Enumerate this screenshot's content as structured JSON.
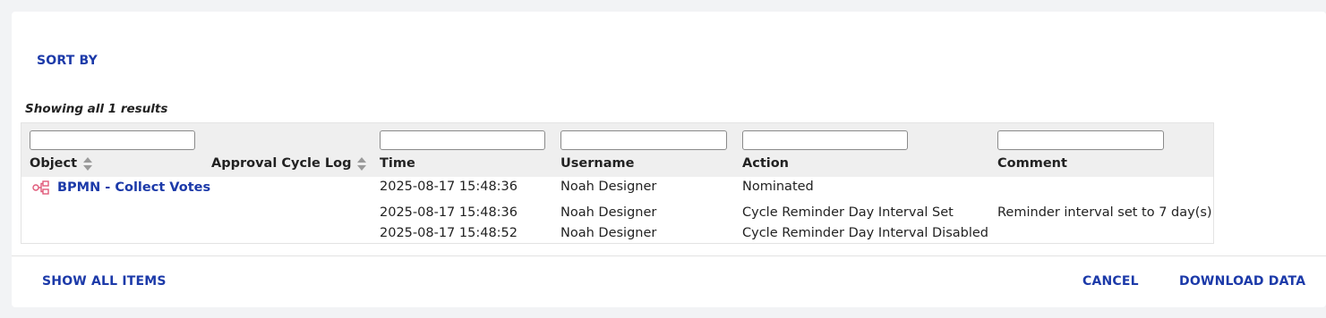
{
  "toolbar": {
    "sort_by": "SORT BY"
  },
  "results_text": "Showing all 1 results",
  "columns": {
    "object": "Object",
    "approval_cycle_log": "Approval Cycle Log",
    "time": "Time",
    "username": "Username",
    "action": "Action",
    "comment": "Comment"
  },
  "rows": [
    {
      "object": "BPMN - Collect Votes",
      "object_icon": "process-icon",
      "entries": [
        {
          "time": "2025-08-17 15:48:36",
          "username": "Noah Designer",
          "action": "Nominated",
          "comment": ""
        },
        {
          "time": "2025-08-17 15:48:36",
          "username": "Noah Designer",
          "action": "Cycle Reminder Day Interval Set",
          "comment": "Reminder interval set to 7 day(s)"
        },
        {
          "time": "2025-08-17 15:48:52",
          "username": "Noah Designer",
          "action": "Cycle Reminder Day Interval Disabled",
          "comment": ""
        }
      ]
    }
  ],
  "footer": {
    "show_all_items": "SHOW ALL ITEMS",
    "cancel": "CANCEL",
    "download_data": "DOWNLOAD DATA"
  },
  "colors": {
    "accent": "#1c3aa9",
    "icon": "#e05a7a",
    "header_bg": "#efefef"
  }
}
